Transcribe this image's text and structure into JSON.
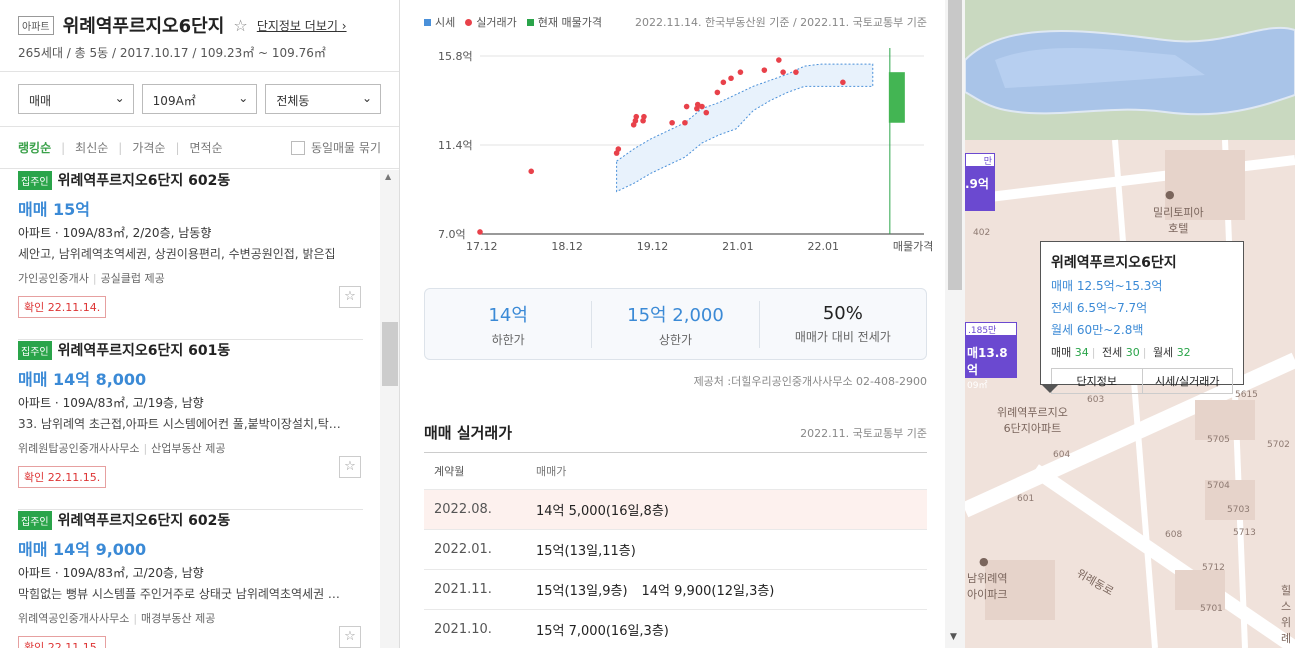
{
  "complex": {
    "type_tag": "아파트",
    "name": "위례역푸르지오6단지",
    "more_link": "단지정보 더보기",
    "info": "265세대 / 총 5동 / 2017.10.17 / 109.23㎡ ~ 109.76㎡"
  },
  "filters": {
    "trade": "매매",
    "area": "109A㎡",
    "building": "전체동"
  },
  "sorts": {
    "ranking": "랭킹순",
    "latest": "최신순",
    "price": "가격순",
    "area": "면적순",
    "group_label": "동일매물 묶기"
  },
  "listings": [
    {
      "badge": "집주인",
      "title": "위례역푸르지오6단지 602동",
      "price": "매매 15억",
      "spec": "아파트 · 109A/83㎡, 2/20층, 남동향",
      "desc": "세안고, 남위례역초역세권, 상권이용편리, 수변공원인접, 밝은집",
      "agent": "가인공인중개사",
      "provider": "공실클럽 제공",
      "confirm": "확인 22.11.14."
    },
    {
      "badge": "집주인",
      "title": "위례역푸르지오6단지 601동",
      "price": "매매 14억 8,000",
      "spec": "아파트 · 109A/83㎡, 고/19층, 남향",
      "desc": "33. 남위례역 초근접,아파트 시스템에어컨 풀,붙박이장설치,탁…",
      "agent": "위례원탑공인중개사사무소",
      "provider": "산업부동산 제공",
      "confirm": "확인 22.11.15."
    },
    {
      "badge": "집주인",
      "title": "위례역푸르지오6단지 602동",
      "price": "매매 14억 9,000",
      "spec": "아파트 · 109A/83㎡, 고/20층, 남향",
      "desc": "막힘없는 뻥뷰 시스템플 주인거주로 상태굿 남위례역초역세권 …",
      "agent": "위례역공인중개사사무소",
      "provider": "매경부동산 제공",
      "confirm": "확인 22.11.15."
    }
  ],
  "chart_legend": {
    "market": "시세",
    "actual": "실거래가",
    "current": "현재 매물가격",
    "source": "2022.11.14. 한국부동산원 기준 / 2022.11. 국토교통부 기준"
  },
  "chart_data": {
    "type": "scatter",
    "y_ticks": [
      "15.8억",
      "11.4억",
      "7.0억"
    ],
    "x_ticks": [
      "17.12",
      "18.12",
      "19.12",
      "21.01",
      "22.01",
      "매물가격"
    ],
    "ylim": [
      7.0,
      15.8
    ],
    "xlim": [
      0,
      52
    ],
    "x_start_label": "17.12",
    "market_band": {
      "x": [
        16,
        18,
        20,
        22,
        24,
        26,
        28,
        30,
        32,
        34,
        36,
        38,
        40,
        42,
        44,
        46
      ],
      "low": [
        9.1,
        9.5,
        10.0,
        10.4,
        10.8,
        11.5,
        11.9,
        12.2,
        13.1,
        13.6,
        14.0,
        14.3,
        14.3,
        14.3,
        14.3,
        14.3
      ],
      "high": [
        10.6,
        11.2,
        11.7,
        12.1,
        12.5,
        13.2,
        13.5,
        13.9,
        14.3,
        14.6,
        14.9,
        15.3,
        15.4,
        15.4,
        15.4,
        15.4
      ]
    },
    "actual_points": [
      {
        "x": 0,
        "y": 7.1
      },
      {
        "x": 6,
        "y": 10.1
      },
      {
        "x": 16,
        "y": 11.0
      },
      {
        "x": 16.2,
        "y": 11.2
      },
      {
        "x": 18,
        "y": 12.4
      },
      {
        "x": 18.2,
        "y": 12.6
      },
      {
        "x": 18.3,
        "y": 12.8
      },
      {
        "x": 19.1,
        "y": 12.6
      },
      {
        "x": 19.2,
        "y": 12.8
      },
      {
        "x": 22.5,
        "y": 12.5
      },
      {
        "x": 24,
        "y": 12.5
      },
      {
        "x": 24.2,
        "y": 13.3
      },
      {
        "x": 25.4,
        "y": 13.2
      },
      {
        "x": 25.5,
        "y": 13.4
      },
      {
        "x": 26,
        "y": 13.3
      },
      {
        "x": 26.5,
        "y": 13.0
      },
      {
        "x": 27.8,
        "y": 14.0
      },
      {
        "x": 28.5,
        "y": 14.5
      },
      {
        "x": 29.4,
        "y": 14.7
      },
      {
        "x": 30.5,
        "y": 15.0
      },
      {
        "x": 33.3,
        "y": 15.1
      },
      {
        "x": 35.0,
        "y": 15.6
      },
      {
        "x": 35.5,
        "y": 15.0
      },
      {
        "x": 37.0,
        "y": 15.0
      },
      {
        "x": 42.5,
        "y": 14.5
      }
    ],
    "current_range": {
      "x": 48,
      "low": 12.5,
      "high": 15.0
    }
  },
  "price_summary": {
    "low_value": "14억",
    "low_label": "하한가",
    "high_value": "15억 2,000",
    "high_label": "상한가",
    "ratio_value": "50%",
    "ratio_label": "매매가 대비 전세가"
  },
  "provider_line": "제공처 :더힐우리공인중개사사무소 02-408-2900",
  "trades": {
    "title": "매매 실거래가",
    "source": "2022.11. 국토교통부 기준",
    "col_month": "계약월",
    "col_price": "매매가",
    "rows": [
      {
        "month": "2022.08.",
        "prices": [
          "14억 5,000(16일,8층)"
        ]
      },
      {
        "month": "2022.01.",
        "prices": [
          "15억(13일,11층)"
        ]
      },
      {
        "month": "2021.11.",
        "prices": [
          "15억(13일,9층)",
          "14억 9,900(12일,3층)"
        ]
      },
      {
        "month": "2021.10.",
        "prices": [
          "15억 7,000(16일,3층)"
        ]
      }
    ]
  },
  "map": {
    "popup_title": "위례역푸르지오6단지",
    "popup_sale": "매매 12.5억~15.3억",
    "popup_jeonse": "전세 6.5억~7.7억",
    "popup_monthly": "월세 60만~2.8백",
    "count_sale_label": "매매",
    "count_sale": "34",
    "count_jeonse_label": "전세",
    "count_jeonse": "30",
    "count_monthly_label": "월세",
    "count_monthly": "32",
    "btn_info": "단지정보",
    "btn_price": "시세/실거래가",
    "marker1_top": "만",
    "marker1": ".9억",
    "marker2_top": ".185만",
    "marker2": "매13.8억",
    "marker2_area": "09㎡",
    "hotel": "밀리토피아\n호텔",
    "apt_label": "위례역푸르지오\n6단지아파트",
    "station_label": "남위례역\n아이파크",
    "road_label": "위례동로",
    "hills_label": "힐스\n위례",
    "nums": [
      "402",
      "603",
      "604",
      "601",
      "5704",
      "5705",
      "5615",
      "5713",
      "5712",
      "5701",
      "5702",
      "608",
      "5703"
    ]
  },
  "colors": {
    "accent_green": "#2aa44a",
    "price_blue": "#3b8ad6",
    "dot_red": "#e8414a",
    "marker_purple": "#6b49d0"
  }
}
